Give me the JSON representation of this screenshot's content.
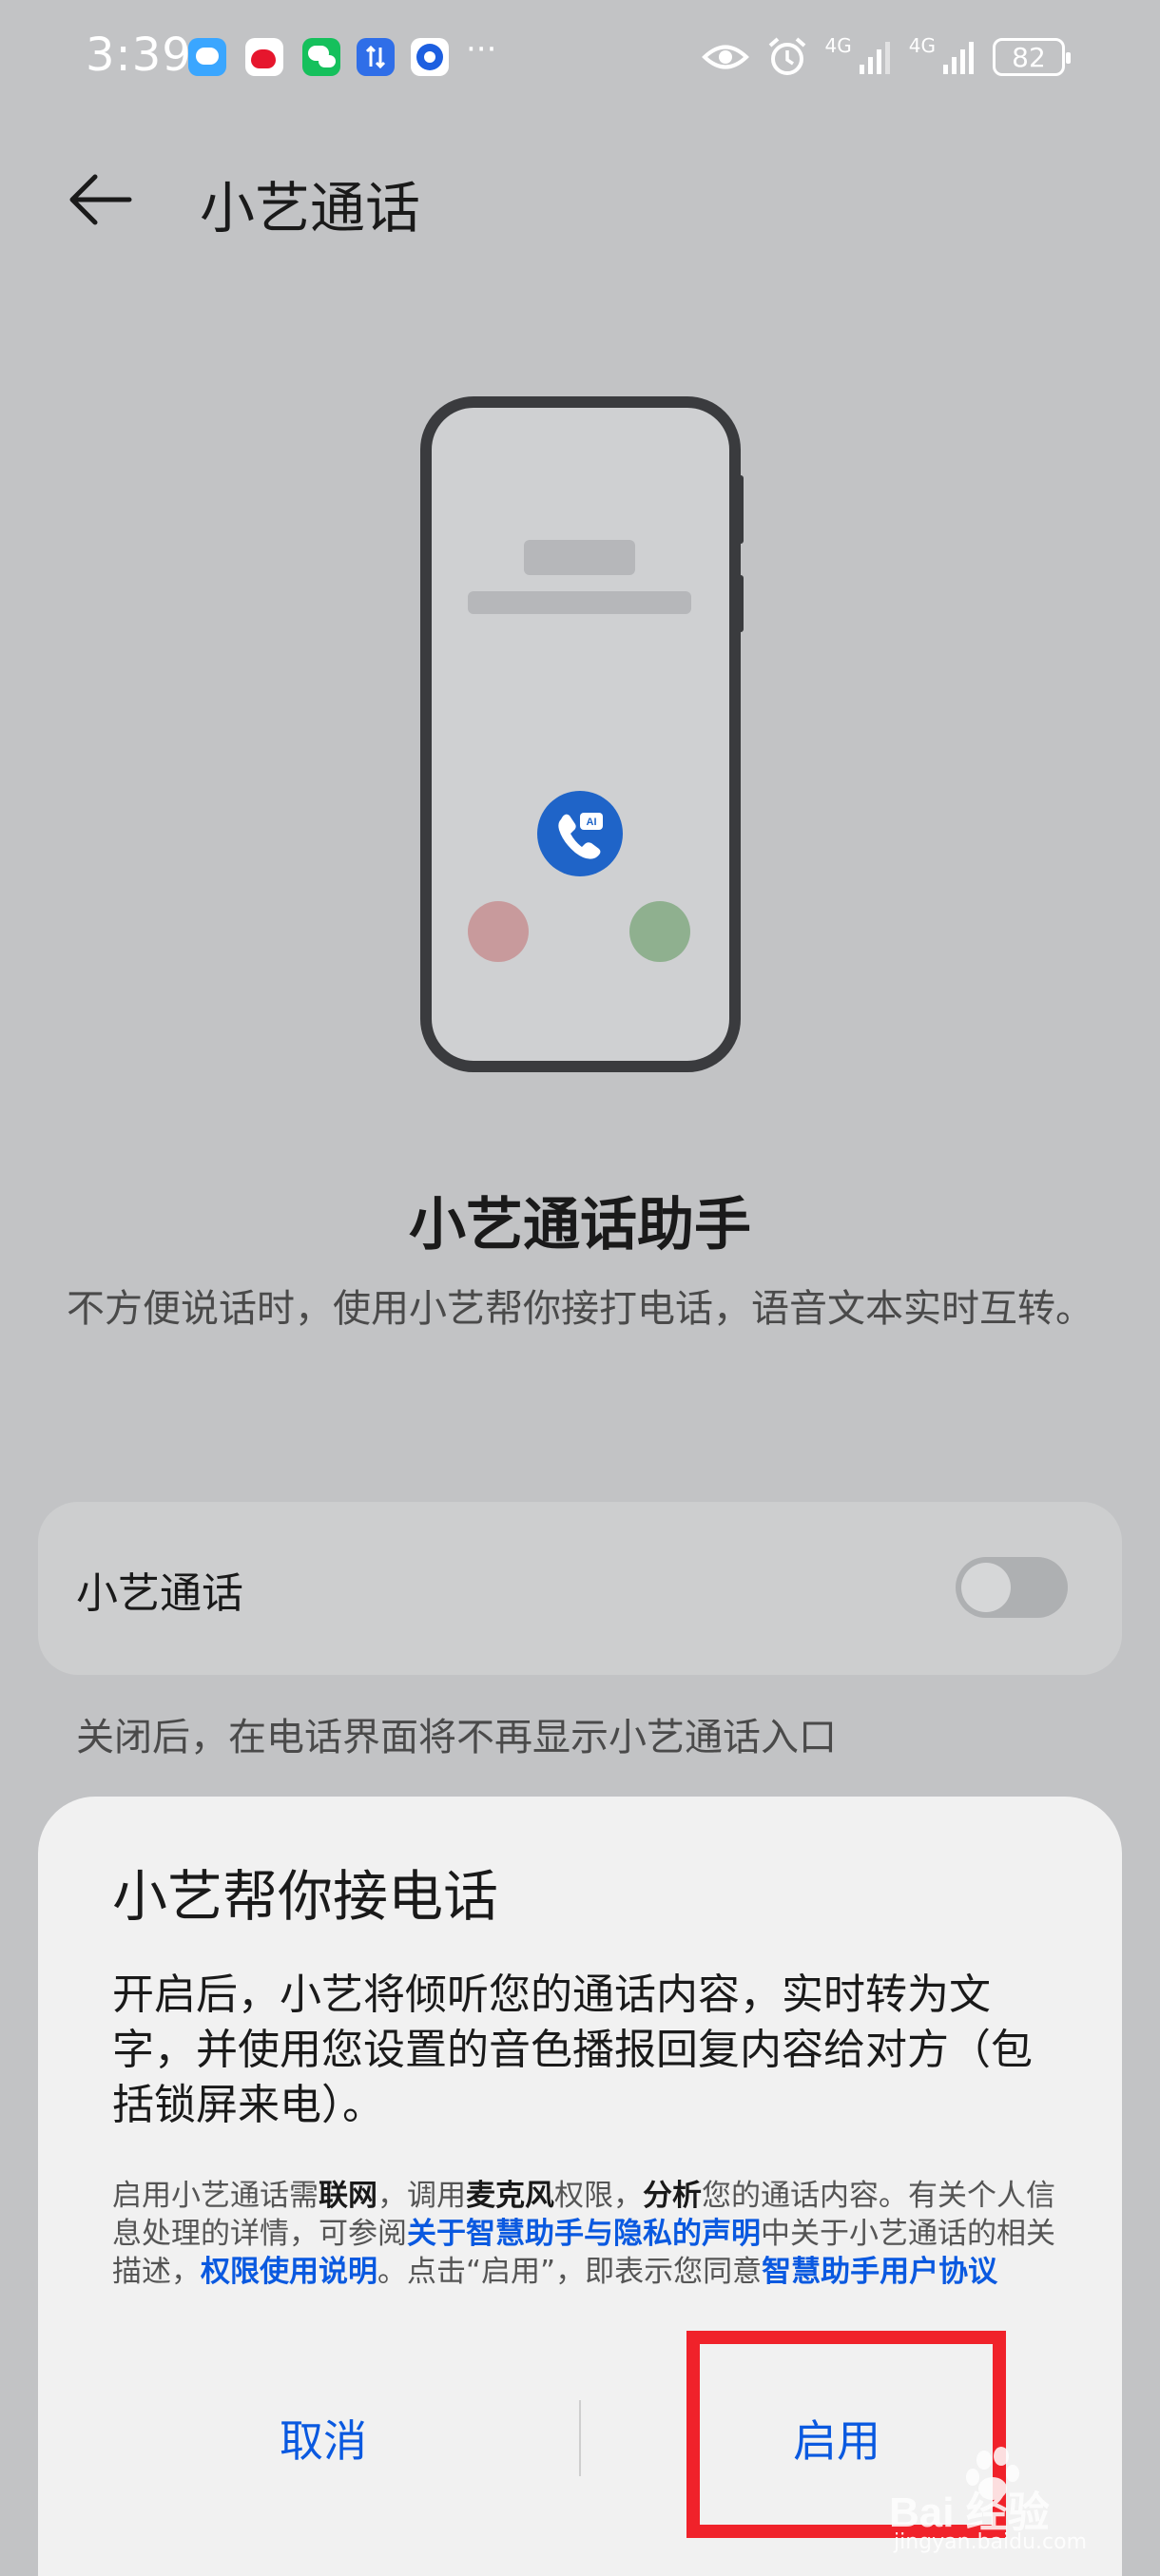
{
  "status_bar": {
    "time": "3:39",
    "more": "···",
    "battery": "82",
    "network_1": "4G",
    "network_2": "4G",
    "icons": [
      "messages-icon",
      "weibo-icon",
      "wechat-icon",
      "data-transfer-icon",
      "browser-icon",
      "eye-icon",
      "alarm-icon",
      "signal-icon",
      "battery-icon"
    ]
  },
  "header": {
    "title": "小艺通话"
  },
  "feature": {
    "title": "小艺通话助手",
    "description": "不方便说话时，使用小艺帮你接打电话，语音文本实时互转。"
  },
  "settings": {
    "toggle_label": "小艺通话",
    "toggle_on": false,
    "toggle_note": "关闭后，在电话界面将不再显示小艺通话入口"
  },
  "dialog": {
    "title": "小艺帮你接电话",
    "body": "开启后，小艺将倾听您的通话内容，实时转为文字，并使用您设置的音色播报回复内容给对方（包括锁屏来电）。",
    "fine_print": {
      "t1": "启用小艺通话需",
      "b1": "联网",
      "t2": "，调用",
      "b2": "麦克风",
      "t3": "权限，",
      "b3": "分析",
      "t4": "您的通话内容。有关个人信息处理的详情，可参阅",
      "link1": "关于智慧助手与隐私的声明",
      "t5": "中关于小艺通话的相关描述，",
      "link2": "权限使用说明",
      "t6": "。点击“启用”，即表示您同意",
      "link3": "智慧助手用户协议"
    },
    "cancel_label": "取消",
    "enable_label": "启用"
  },
  "watermark": {
    "text": "Bai 经验",
    "sub": "jingyan.baidu.com"
  },
  "colors": {
    "accent": "#0a59e0",
    "highlight": "#f0222a",
    "ai_badge": "#1f64c8",
    "decline": "#c89a9c",
    "accept": "#8fb08f"
  }
}
